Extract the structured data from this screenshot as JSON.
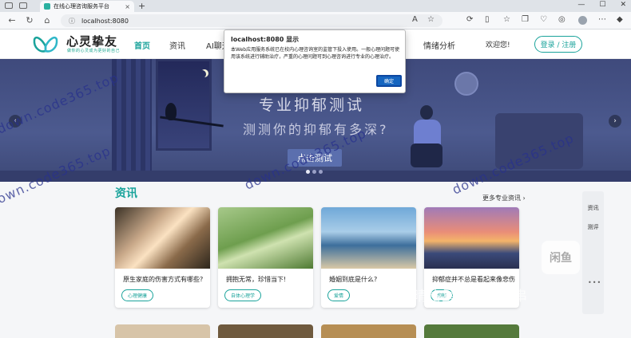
{
  "browser": {
    "tab_title": "在线心理咨询服务平台",
    "tab_close": "×",
    "new_tab": "+",
    "window_controls": [
      "—",
      "☐",
      "✕"
    ],
    "url": "localhost:8080",
    "url_icon": "ⓘ"
  },
  "header": {
    "brand": "心灵挚友",
    "slogan": "做你的心灵成为更好的自己",
    "nav": [
      "首页",
      "资讯",
      "AI聊天",
      "情绪分析"
    ],
    "welcome": "欢迎您!",
    "login": "登录 / 注册"
  },
  "banner": {
    "headline": "专业抑郁测试",
    "subline": "测测你的抑郁有多深?",
    "cta": "点击测试",
    "prev": "‹",
    "next": "›"
  },
  "news": {
    "title": "资讯",
    "more": "更多专业资讯 ›",
    "cards": [
      {
        "title": "原生家庭的伤害方式有哪些?",
        "tag": "心理健康"
      },
      {
        "title": "拥抱无常，珍惜当下!",
        "tag": "自体心理学"
      },
      {
        "title": "婚姻到底是什么?",
        "tag": "爱情"
      },
      {
        "title": "抑郁症并不总是看起来像悲伤",
        "tag": "抑郁"
      }
    ]
  },
  "side": {
    "items": [
      "资讯",
      "测评"
    ],
    "dots": "•••"
  },
  "dialog": {
    "title": "localhost:8080 显示",
    "message": "本Web应用服务系统已在校内心理咨询室的监管下投入使用。一般心理问题可使用该系统进行辅助治疗，严重的心理问题可到心理咨询进行专业的心理治疗。",
    "ok": "确定"
  },
  "watermarks": {
    "site": "down.code365.top",
    "xianyu": "闲鱼号：晴格星朴素的串串",
    "xianyu_logo": "闲鱼"
  }
}
